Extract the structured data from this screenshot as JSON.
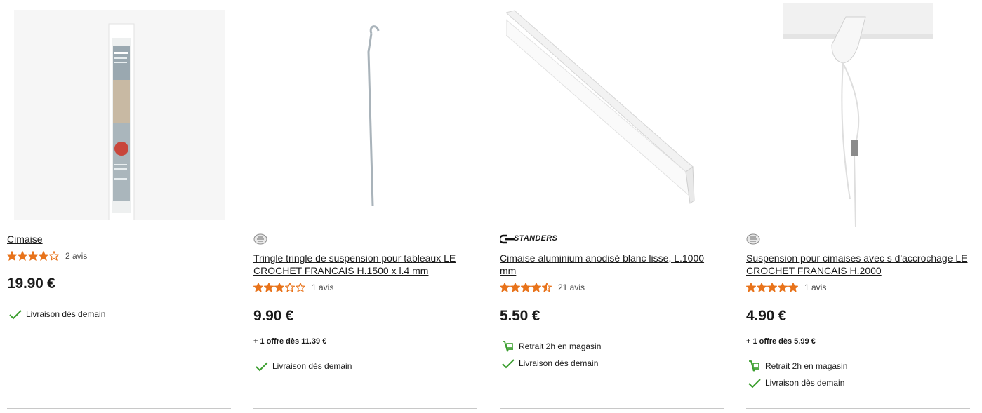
{
  "colors": {
    "star": "#e8731b",
    "check": "#3b9e2e",
    "divider": "#c8c8c8"
  },
  "products": [
    {
      "brand": "",
      "title": "Cimaise",
      "rating": 4,
      "reviews": "2 avis",
      "price": "19.90 €",
      "offer": "",
      "pickup": "",
      "delivery": "Livraison dès demain"
    },
    {
      "brand": "le-crochet-francais-logo",
      "title": "Tringle tringle de suspension pour tableaux LE CROCHET FRANCAIS H.1500 x l.4 mm",
      "rating": 3,
      "reviews": "1 avis",
      "price": "9.90 €",
      "offer": "+ 1 offre dès 11.39 €",
      "pickup": "",
      "delivery": "Livraison dès demain"
    },
    {
      "brand": "STANDERS",
      "title": "Cimaise aluminium anodisé blanc lisse, L.1000 mm",
      "rating": 4.5,
      "reviews": "21 avis",
      "price": "5.50 €",
      "offer": "",
      "pickup": "Retrait 2h en magasin",
      "delivery": "Livraison dès demain"
    },
    {
      "brand": "le-crochet-francais-logo",
      "title": "Suspension pour cimaises avec s d'accrochage LE CROCHET FRANCAIS H.2000",
      "rating": 5,
      "reviews": "1 avis",
      "price": "4.90 €",
      "offer": "+ 1 offre dès 5.99 €",
      "pickup": "Retrait 2h en magasin",
      "delivery": "Livraison dès demain"
    }
  ]
}
